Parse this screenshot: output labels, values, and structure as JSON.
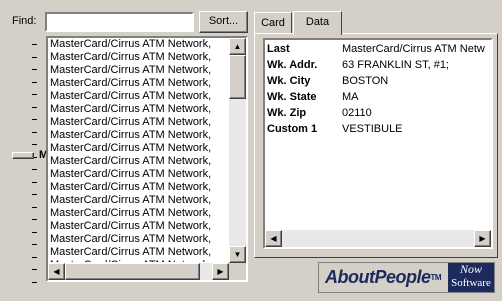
{
  "find": {
    "label": "Find:",
    "value": "",
    "sort_label": "Sort..."
  },
  "slider": {
    "current_letter": "M"
  },
  "list": {
    "items": [
      "MasterCard/Cirrus ATM Network,",
      "MasterCard/Cirrus ATM Network,",
      "MasterCard/Cirrus ATM Network,",
      "MasterCard/Cirrus ATM Network,",
      "MasterCard/Cirrus ATM Network,",
      "MasterCard/Cirrus ATM Network,",
      "MasterCard/Cirrus ATM Network,",
      "MasterCard/Cirrus ATM Network,",
      "MasterCard/Cirrus ATM Network,",
      "MasterCard/Cirrus ATM Network,",
      "MasterCard/Cirrus ATM Network,",
      "MasterCard/Cirrus ATM Network,",
      "MasterCard/Cirrus ATM Network,",
      "MasterCard/Cirrus ATM Network,",
      "MasterCard/Cirrus ATM Network,",
      "MasterCard/Cirrus ATM Network,",
      "MasterCard/Cirrus ATM Network,",
      "MasterCard/Cirrus ATM Network"
    ],
    "up_arrow": "▲",
    "down_arrow": "▼",
    "left_arrow": "◀",
    "right_arrow": "▶"
  },
  "tabs": [
    {
      "label": "Card"
    },
    {
      "label": "Data"
    }
  ],
  "data_fields": [
    {
      "name": "Last",
      "value": "MasterCard/Cirrus ATM Netw"
    },
    {
      "name": "Wk. Addr.",
      "value": "63 FRANKLIN ST, #1;"
    },
    {
      "name": "Wk. City",
      "value": "BOSTON"
    },
    {
      "name": "Wk. State",
      "value": "MA"
    },
    {
      "name": "Wk. Zip",
      "value": "02110"
    },
    {
      "name": "Custom 1",
      "value": "VESTIBULE"
    }
  ],
  "logo": {
    "product": "AboutPeople",
    "tm": "TM",
    "vendor_line1": "Now",
    "vendor_line2": "Software",
    "brand_color": "#1c2a5e"
  }
}
